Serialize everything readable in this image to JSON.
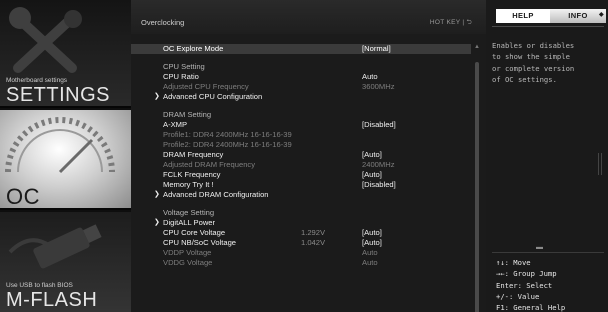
{
  "nav": {
    "settings": {
      "caption": "Motherboard settings",
      "title": "SETTINGS"
    },
    "oc": {
      "title": "OC"
    },
    "mflash": {
      "caption": "Use USB to flash BIOS",
      "title": "M-FLASH"
    }
  },
  "panel": {
    "title": "Overclocking",
    "hotkey": "HOT KEY | ⮌"
  },
  "rows": [
    {
      "label": "OC Explore Mode",
      "mid": "",
      "value": "[Normal]",
      "style": "sel",
      "arrow": false
    },
    {
      "label": "CPU Setting",
      "mid": "",
      "value": "",
      "style": "header",
      "arrow": false
    },
    {
      "label": "CPU Ratio",
      "mid": "",
      "value": "Auto",
      "style": "norm",
      "arrow": false
    },
    {
      "label": "Adjusted CPU Frequency",
      "mid": "",
      "value": "3600MHz",
      "style": "dim",
      "arrow": false
    },
    {
      "label": "Advanced CPU Configuration",
      "mid": "",
      "value": "",
      "style": "norm",
      "arrow": true
    },
    {
      "label": "DRAM Setting",
      "mid": "",
      "value": "",
      "style": "header",
      "arrow": false
    },
    {
      "label": "A-XMP",
      "mid": "",
      "value": "[Disabled]",
      "style": "norm",
      "arrow": false
    },
    {
      "label": "Profile1: DDR4 2400MHz 16-16-16-39",
      "mid": "",
      "value": "",
      "style": "dim",
      "arrow": false
    },
    {
      "label": "Profile2: DDR4 2400MHz 16-16-16-39",
      "mid": "",
      "value": "",
      "style": "dim",
      "arrow": false
    },
    {
      "label": "DRAM Frequency",
      "mid": "",
      "value": "[Auto]",
      "style": "norm",
      "arrow": false
    },
    {
      "label": "Adjusted DRAM Frequency",
      "mid": "",
      "value": "2400MHz",
      "style": "dim",
      "arrow": false
    },
    {
      "label": "FCLK Frequency",
      "mid": "",
      "value": "[Auto]",
      "style": "norm",
      "arrow": false
    },
    {
      "label": "Memory Try It !",
      "mid": "",
      "value": "[Disabled]",
      "style": "norm",
      "arrow": false
    },
    {
      "label": "Advanced DRAM Configuration",
      "mid": "",
      "value": "",
      "style": "norm",
      "arrow": true
    },
    {
      "label": "Voltage Setting",
      "mid": "",
      "value": "",
      "style": "header",
      "arrow": false
    },
    {
      "label": "DigitALL Power",
      "mid": "",
      "value": "",
      "style": "norm",
      "arrow": true
    },
    {
      "label": "CPU Core Voltage",
      "mid": "1.292V",
      "value": "[Auto]",
      "style": "norm",
      "arrow": false
    },
    {
      "label": "CPU NB/SoC Voltage",
      "mid": "1.042V",
      "value": "[Auto]",
      "style": "norm",
      "arrow": false
    },
    {
      "label": "VDDP Voltage",
      "mid": "",
      "value": "Auto",
      "style": "dim",
      "arrow": false
    },
    {
      "label": "VDDG Voltage",
      "mid": "",
      "value": "Auto",
      "style": "dim",
      "arrow": false
    }
  ],
  "help": {
    "tab_help": "HELP",
    "tab_info": "INFO",
    "text": [
      "Enables or disables",
      "to show the simple",
      "or complete version",
      "of OC settings."
    ],
    "keys": [
      "↑↓: Move",
      "→←: Group Jump",
      "Enter: Select",
      "+/-: Value",
      "F1: General Help"
    ]
  }
}
